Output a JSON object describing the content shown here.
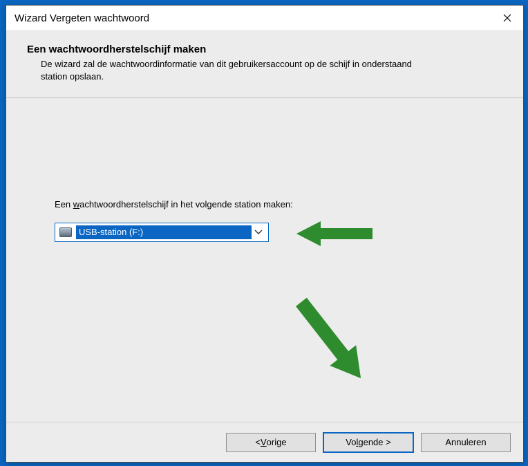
{
  "window": {
    "title": "Wizard Vergeten wachtwoord"
  },
  "header": {
    "heading": "Een wachtwoordherstelschijf maken",
    "description": "De wizard zal de wachtwoordinformatie van dit gebruikersaccount op de schijf in onderstaand station opslaan."
  },
  "content": {
    "prompt_prefix": "Een ",
    "prompt_underlined": "w",
    "prompt_suffix": "achtwoordherstelschijf in het volgende station maken:",
    "drive_selection": "USB-station (F:)"
  },
  "footer": {
    "back_prefix": "< ",
    "back_underlined": "V",
    "back_suffix": "orige",
    "next_prefix": "Vo",
    "next_underlined": "l",
    "next_suffix": "gende >",
    "cancel": "Annuleren"
  }
}
